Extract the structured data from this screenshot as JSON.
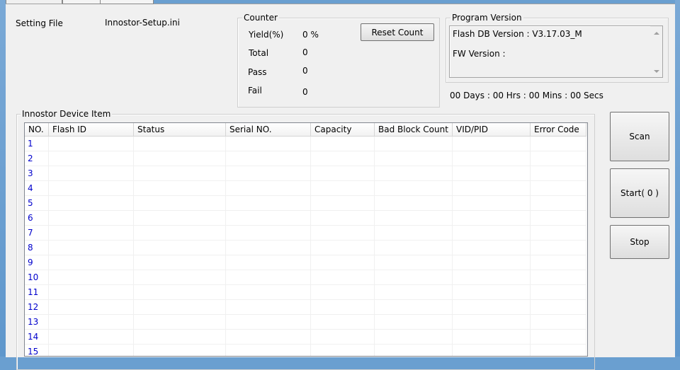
{
  "setting_file": {
    "label": "Setting File",
    "value": "Innostor-Setup.ini"
  },
  "counter": {
    "title": "Counter",
    "rows": [
      {
        "label": "Yield(%)",
        "value": "0 %"
      },
      {
        "label": "Total",
        "value": "0"
      },
      {
        "label": "Pass",
        "value": "0"
      },
      {
        "label": "Fail",
        "value": "0"
      }
    ],
    "reset_label": "Reset Count"
  },
  "program_version": {
    "title": "Program Version",
    "flash_db": "Flash DB Version :  V3.17.03_M",
    "fw": "FW Version :"
  },
  "timer": "00 Days : 00 Hrs : 00 Mins : 00 Secs",
  "device_group": {
    "title": "Innostor Device Item",
    "columns": [
      "NO.",
      "Flash ID",
      "Status",
      "Serial NO.",
      "Capacity",
      "Bad Block Count",
      "VID/PID",
      "Error Code"
    ],
    "rows": [
      "1",
      "2",
      "3",
      "4",
      "5",
      "6",
      "7",
      "8",
      "9",
      "10",
      "11",
      "12",
      "13",
      "14",
      "15"
    ]
  },
  "buttons": {
    "scan": "Scan",
    "start": "Start( 0 )",
    "stop": "Stop"
  }
}
